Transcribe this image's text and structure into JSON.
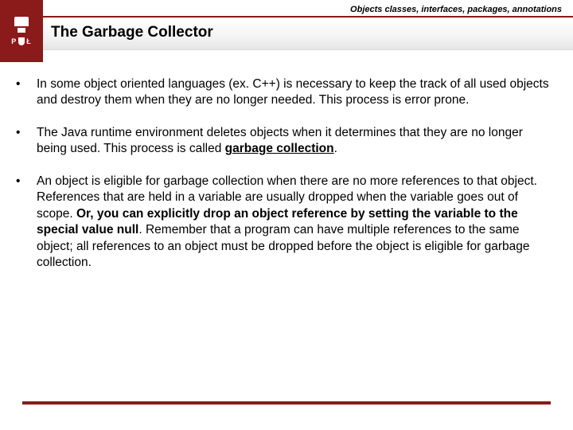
{
  "header": {
    "breadcrumb": "Objects classes, interfaces, packages, annotations",
    "logo_left": "P",
    "logo_right": "Ł"
  },
  "title": "The Garbage Collector",
  "bullets": [
    {
      "parts": [
        {
          "text": "In some object oriented languages (ex. C++) is necessary to keep the track of all used objects and destroy them when they are no longer needed. This process is error prone.",
          "style": "normal"
        }
      ]
    },
    {
      "parts": [
        {
          "text": "The Java runtime environment deletes objects when it determines that they are no longer being used. This process is called ",
          "style": "normal"
        },
        {
          "text": "garbage collection",
          "style": "bold-underline"
        },
        {
          "text": ".",
          "style": "normal"
        }
      ]
    },
    {
      "parts": [
        {
          "text": "An object is eligible for garbage collection when there are no more references to that object. References that are held in a variable are usually dropped when the variable goes out of scope. ",
          "style": "normal"
        },
        {
          "text": "Or, you can explicitly drop an object reference by setting the variable to the special value null",
          "style": "bold"
        },
        {
          "text": ". Remember that a program can have multiple references to the same object; all references to an object must be dropped before the object is eligible for garbage collection.",
          "style": "normal"
        }
      ]
    }
  ]
}
